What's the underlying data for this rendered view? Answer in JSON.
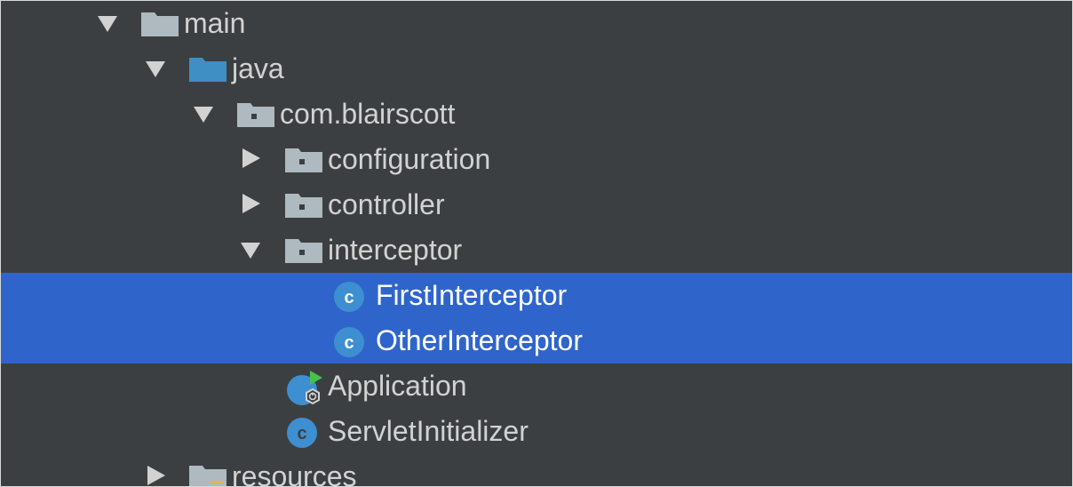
{
  "project_tree": {
    "rows": [
      {
        "label": "main",
        "expanded": true,
        "icon": "folder-icon"
      },
      {
        "label": "java",
        "expanded": true,
        "icon": "source-folder-icon"
      },
      {
        "label": "com.blairscott",
        "expanded": true,
        "icon": "package-icon"
      },
      {
        "label": "configuration",
        "expanded": false,
        "icon": "package-icon"
      },
      {
        "label": "controller",
        "expanded": false,
        "icon": "package-icon"
      },
      {
        "label": "interceptor",
        "expanded": true,
        "icon": "package-icon"
      },
      {
        "label": "FirstInterceptor",
        "selected": true,
        "icon": "class-icon"
      },
      {
        "label": "OtherInterceptor",
        "selected": true,
        "icon": "class-icon"
      },
      {
        "label": "Application",
        "icon": "spring-boot-class-icon"
      },
      {
        "label": "ServletInitializer",
        "icon": "class-icon"
      },
      {
        "label": "resources",
        "expanded": false,
        "icon": "resources-folder-icon"
      }
    ],
    "class_icon_letter": "c",
    "colors": {
      "background": "#3c3f41",
      "selection": "#2f65ca",
      "text": "#d2d2d2",
      "selected_text": "#ffffff",
      "folder": "#aeb9c0",
      "source_folder": "#3f8ec4",
      "class_icon": "#3d8fd1",
      "run_badge": "#45c14e"
    }
  }
}
